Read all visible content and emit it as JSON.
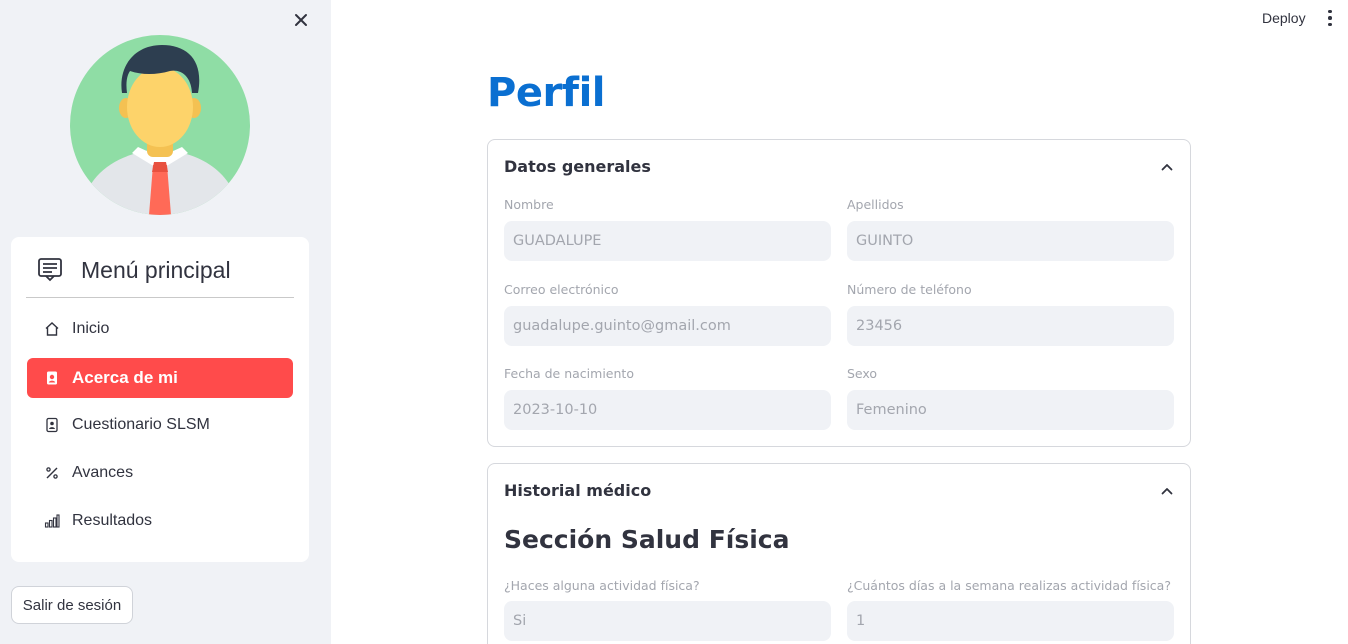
{
  "sidebar": {
    "menu_title": "Menú principal",
    "items": [
      {
        "label": "Inicio",
        "icon": "house-icon"
      },
      {
        "label": "Acerca de mi",
        "icon": "person-badge-icon",
        "active": true
      },
      {
        "label": "Cuestionario SLSM",
        "icon": "clipboard-icon"
      },
      {
        "label": "Avances",
        "icon": "percent-icon"
      },
      {
        "label": "Resultados",
        "icon": "bar-chart-icon"
      }
    ],
    "logout_label": "Salir de sesión",
    "active_color": "#ff4b4b"
  },
  "topbar": {
    "deploy_label": "Deploy"
  },
  "main": {
    "title": "Perfil",
    "title_color": "#0a6fd1",
    "general": {
      "title": "Datos generales",
      "fields": {
        "nombre": {
          "label": "Nombre",
          "value": "GUADALUPE"
        },
        "apellidos": {
          "label": "Apellidos",
          "value": "GUINTO"
        },
        "correo": {
          "label": "Correo electrónico",
          "value": "guadalupe.guinto@gmail.com"
        },
        "telefono": {
          "label": "Número de teléfono",
          "value": "23456"
        },
        "nacimiento": {
          "label": "Fecha de nacimiento",
          "value": "2023-10-10"
        },
        "sexo": {
          "label": "Sexo",
          "value": "Femenino"
        }
      }
    },
    "historial": {
      "title": "Historial médico",
      "section_title": "Sección Salud Física",
      "fields": {
        "actividad": {
          "label": "¿Haces alguna actividad física?",
          "value": "Si"
        },
        "dias": {
          "label": "¿Cuántos días a la semana realizas actividad física?",
          "value": "1"
        }
      }
    }
  }
}
